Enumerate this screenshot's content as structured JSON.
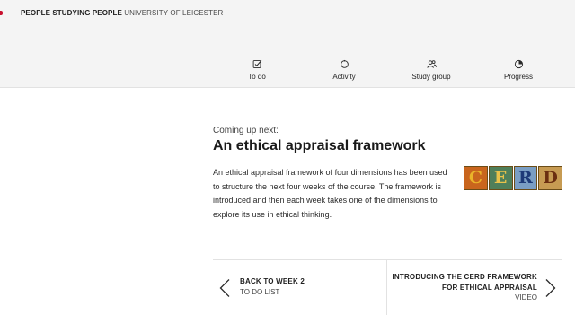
{
  "header": {
    "course_name": "PEOPLE STUDYING PEOPLE",
    "organisation": "UNIVERSITY OF LEICESTER",
    "brand_color": "#c8102e"
  },
  "nav": {
    "items": [
      {
        "label": "To do",
        "icon": "todo-icon"
      },
      {
        "label": "Activity",
        "icon": "activity-icon"
      },
      {
        "label": "Study group",
        "icon": "study-group-icon"
      },
      {
        "label": "Progress",
        "icon": "progress-icon"
      }
    ]
  },
  "main": {
    "kicker": "Coming up next:",
    "title": "An ethical appraisal framework",
    "summary": "An ethical appraisal framework of four dimensions has been used to structure the next four weeks of the course. The framework is introduced and then each week takes one of the dimensions to explore its use in ethical thinking.",
    "thumbnail_letters": [
      "C",
      "E",
      "R",
      "D"
    ]
  },
  "step_nav": {
    "prev": {
      "title": "BACK TO WEEK 2",
      "subtitle": "TO DO LIST",
      "icon": "chevron-left-icon"
    },
    "next": {
      "title": "INTRODUCING THE CERD FRAMEWORK FOR ETHICAL APPRAISAL",
      "subtitle": "VIDEO",
      "icon": "chevron-right-icon"
    }
  }
}
